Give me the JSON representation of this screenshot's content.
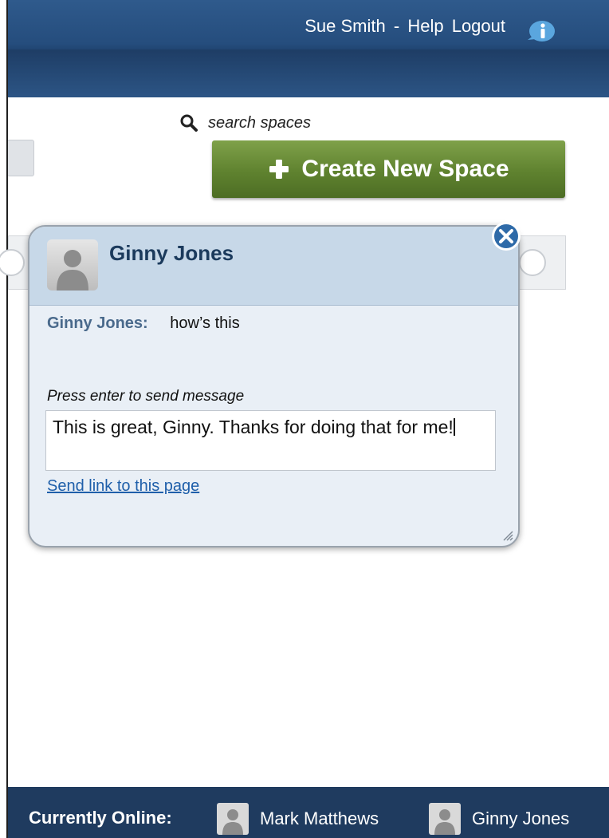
{
  "header": {
    "user_name": "Sue Smith",
    "separator": "-",
    "help_label": "Help",
    "logout_label": "Logout",
    "info_icon": "info-bubble-icon",
    "search": {
      "placeholder": "search spaces",
      "icon": "search-icon"
    }
  },
  "actions": {
    "create_space_label": "Create New Space",
    "create_space_icon": "plus-icon"
  },
  "chat": {
    "contact_name": "Ginny Jones",
    "messages": [
      {
        "sender": "Ginny Jones:",
        "text": "how’s this"
      }
    ],
    "hint": "Press enter to send message",
    "draft": "This is great, Ginny.  Thanks for doing that for me!",
    "send_link_label": "Send link to this page"
  },
  "footer": {
    "online_label": "Currently Online:",
    "online_users": [
      {
        "name": "Mark Matthews"
      },
      {
        "name": "Ginny Jones"
      }
    ]
  },
  "colors": {
    "header": "#254d7d",
    "create_button": "#5f822f",
    "chat_header": "#c7d8e8",
    "footer": "#1f3b5f",
    "link": "#1f5faa"
  }
}
